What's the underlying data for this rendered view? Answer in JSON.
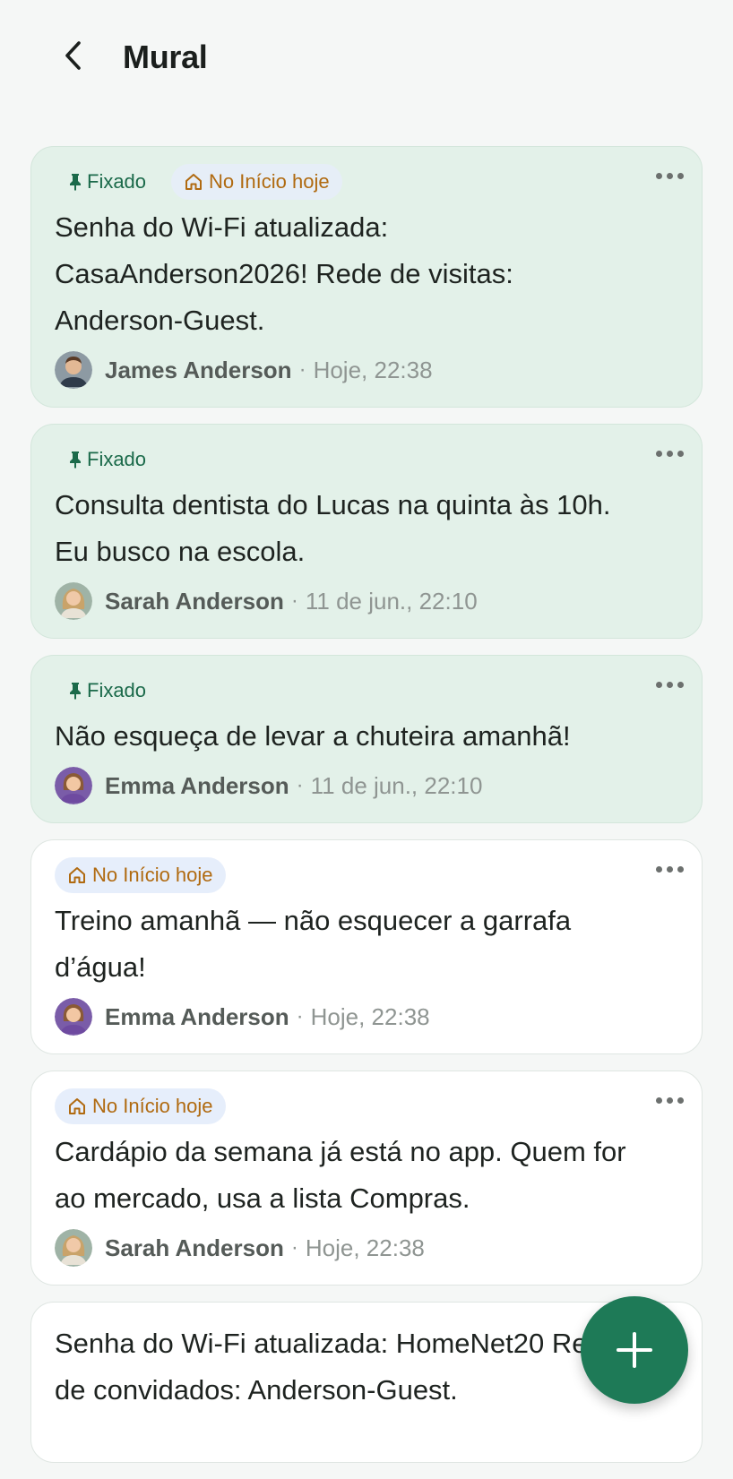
{
  "header": {
    "title": "Mural"
  },
  "chips": {
    "pinned": "Fixado",
    "home": "No Início hoje"
  },
  "posts": [
    {
      "pinned": true,
      "home": true,
      "text": "Senha do Wi-Fi atualizada: CasaAnderson2026! Rede de visitas: Anderson-Guest.",
      "author": "James Anderson",
      "time": "Hoje, 22:38",
      "avatar": "avatar-man-icon"
    },
    {
      "pinned": true,
      "home": false,
      "text": "Consulta dentista do Lucas na quinta às 10h. Eu busco na escola.",
      "author": "Sarah Anderson",
      "time": "11 de jun., 22:10",
      "avatar": "avatar-woman-icon"
    },
    {
      "pinned": true,
      "home": false,
      "text": "Não esqueça de levar a chuteira amanhã!",
      "author": "Emma Anderson",
      "time": "11 de jun., 22:10",
      "avatar": "avatar-girl-icon"
    },
    {
      "pinned": false,
      "home": true,
      "text": "Treino amanhã — não esquecer a garrafa d’água!",
      "author": "Emma Anderson",
      "time": "Hoje, 22:38",
      "avatar": "avatar-girl-icon"
    },
    {
      "pinned": false,
      "home": true,
      "text": "Cardápio da semana já está no app. Quem for ao mercado, usa a lista Compras.",
      "author": "Sarah Anderson",
      "time": "Hoje, 22:38",
      "avatar": "avatar-woman-icon"
    },
    {
      "pinned": false,
      "home": false,
      "text": "Senha do Wi-Fi atualizada: HomeNet20 Rede de convidados: Anderson-Guest.",
      "author": "",
      "time": "",
      "avatar": ""
    }
  ],
  "colors": {
    "accent": "#1e7a57",
    "pinned_bg": "#e3f1e9",
    "pinned_text": "#1b6a4a",
    "home_text": "#b06a10",
    "home_bg": "#e6eefb"
  },
  "icons": {
    "back": "chevron-left-icon",
    "pin": "pin-icon",
    "home": "house-icon",
    "more": "more-horizontal-icon",
    "fab": "plus-icon"
  }
}
